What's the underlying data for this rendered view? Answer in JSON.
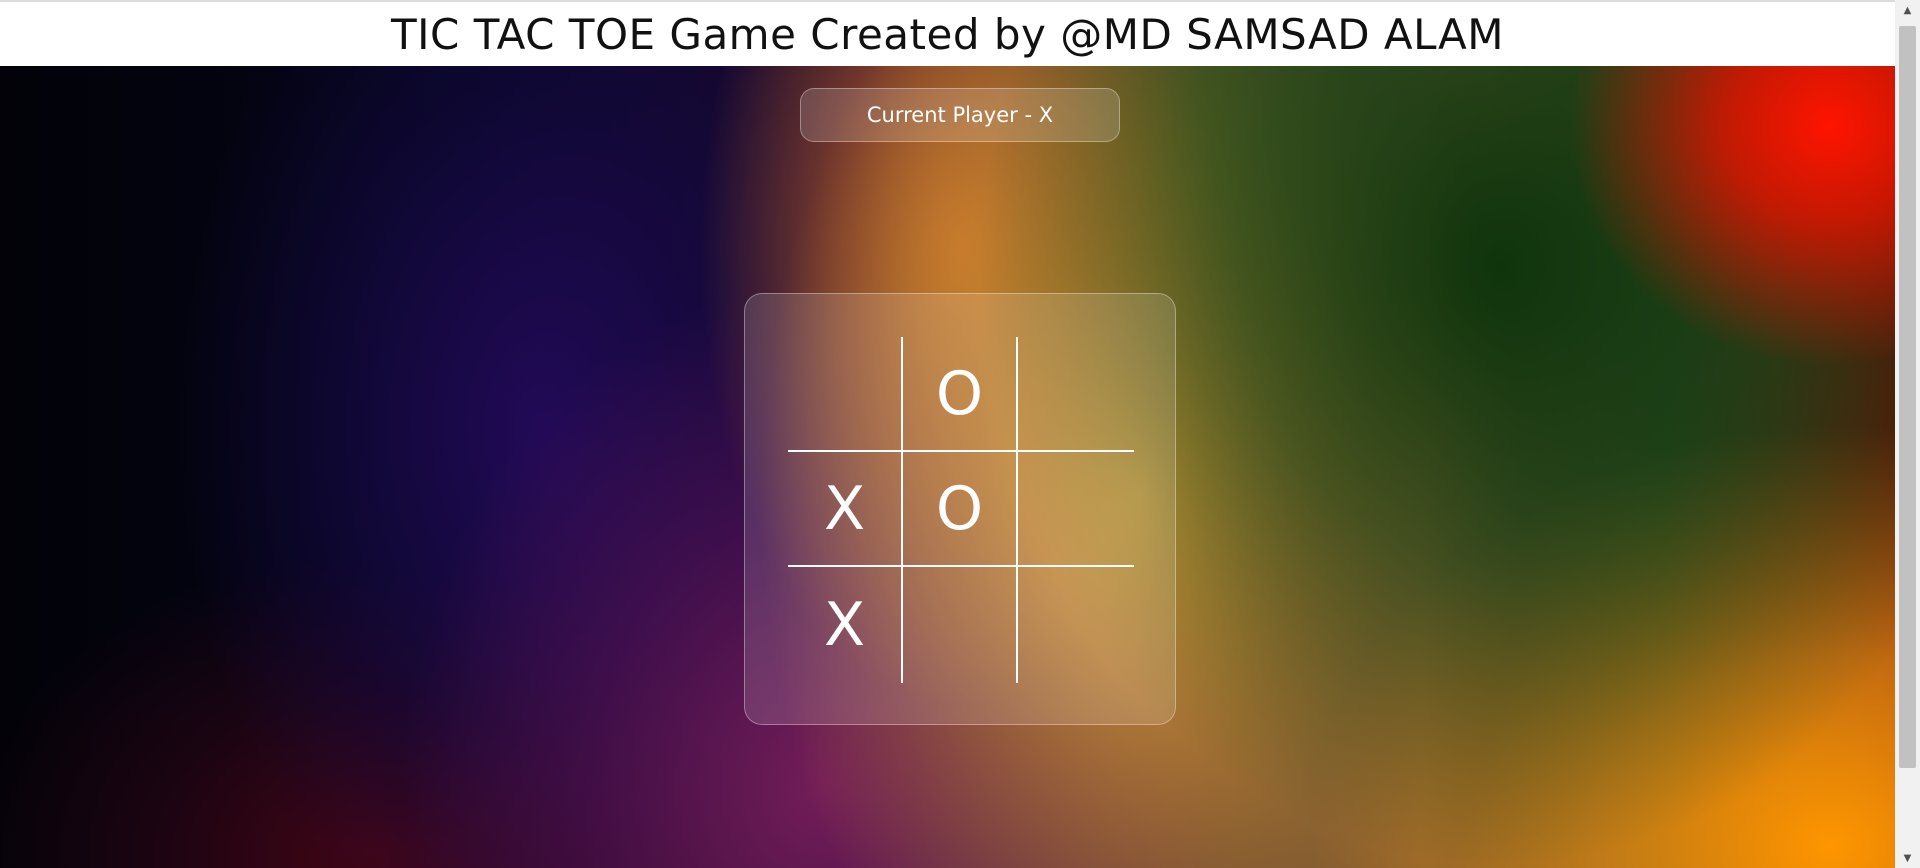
{
  "header": {
    "title": "TIC TAC TOE Game Created by @MD SAMSAD ALAM"
  },
  "status": {
    "text": "Current Player - X"
  },
  "board": {
    "cells": [
      "",
      "O",
      "",
      "X",
      "O",
      "",
      "X",
      "",
      ""
    ]
  },
  "scrollbar": {
    "up_icon": "arrow-up-icon",
    "down_icon": "arrow-down-icon"
  }
}
